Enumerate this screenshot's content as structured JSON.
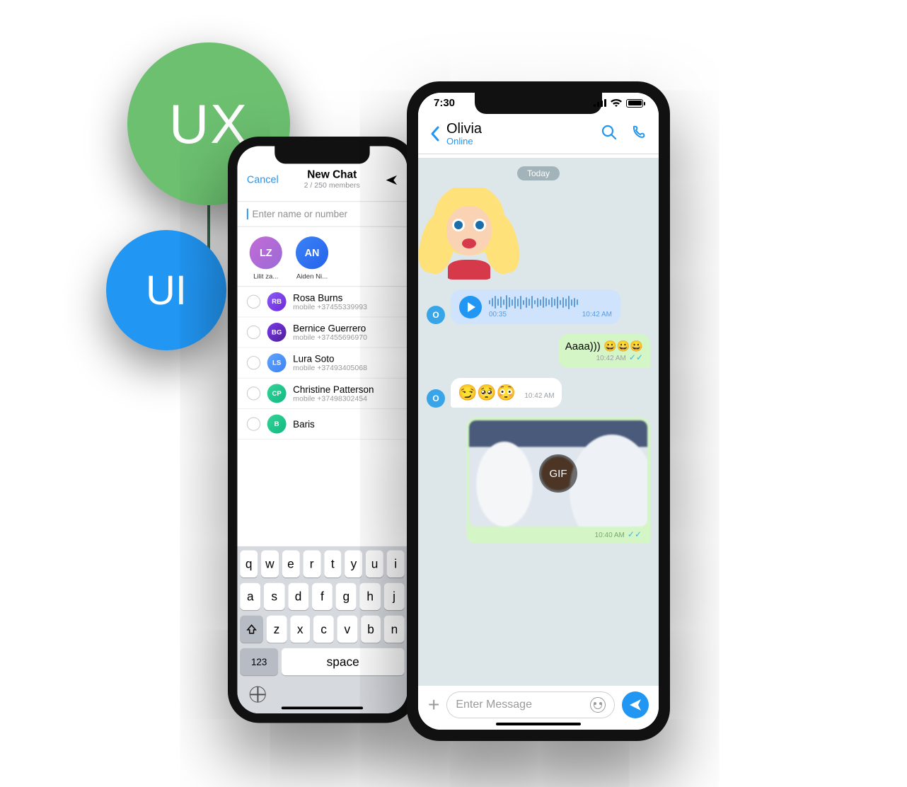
{
  "badges": {
    "ux": "UX",
    "ui": "UI"
  },
  "newChat": {
    "cancel": "Cancel",
    "title": "New Chat",
    "memberCount": "2 / 250 members",
    "inputPlaceholder": "Enter name or number",
    "selected": [
      {
        "initials": "LZ",
        "name": "Lilit za..."
      },
      {
        "initials": "AN",
        "name": "Aiden Ni..."
      }
    ],
    "contacts": [
      {
        "initials": "RB",
        "name": "Rosa Burns",
        "phone": "mobile +37455339993"
      },
      {
        "initials": "BG",
        "name": "Bernice Guerrero",
        "phone": "mobile +37455696970"
      },
      {
        "initials": "LS",
        "name": "Lura Soto",
        "phone": "mobile +37493405068"
      },
      {
        "initials": "CP",
        "name": "Christine Patterson",
        "phone": "mobile +37498302454"
      },
      {
        "initials": "B",
        "name": "Baris",
        "phone": ""
      }
    ],
    "keyboard": {
      "rows": [
        [
          "q",
          "w",
          "e",
          "r",
          "t",
          "y",
          "u",
          "i"
        ],
        [
          "a",
          "s",
          "d",
          "f",
          "g",
          "h",
          "j"
        ],
        [
          "z",
          "x",
          "c",
          "v",
          "b",
          "n"
        ]
      ],
      "numKey": "123",
      "space": "space"
    }
  },
  "chat": {
    "status": {
      "time": "7:30"
    },
    "header": {
      "name": "Olivia",
      "presence": "Online"
    },
    "dateBadge": "Today",
    "avatarLetter": "O",
    "voice": {
      "duration": "00:35",
      "time": "10:42 AM"
    },
    "outText": {
      "text": "Aaaa)))",
      "emoji": "😀😀😀",
      "time": "10:42 AM"
    },
    "inEmoji": {
      "emoji": "😏🥺😳",
      "time": "10:42 AM"
    },
    "gif": {
      "tag": "GIF",
      "time": "10:40 AM"
    },
    "input": {
      "placeholder": "Enter Message"
    }
  }
}
